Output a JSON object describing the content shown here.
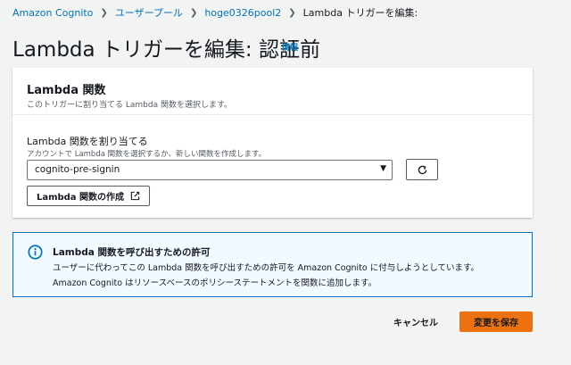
{
  "breadcrumb": {
    "items": [
      "Amazon Cognito",
      "ユーザープール",
      "hoge0326pool2"
    ],
    "current": "Lambda トリガーを編集:"
  },
  "header": {
    "title": "Lambda トリガーを編集: 認証前",
    "info_link": "情報"
  },
  "panel": {
    "title": "Lambda 関数",
    "description": "このトリガーに割り当てる Lambda 関数を選択します。",
    "field_label": "Lambda 関数を割り当てる",
    "field_description": "アカウントで Lambda 関数を選択するか、新しい関数を作成します。",
    "selected_function": "cognito-pre-signin",
    "create_button": "Lambda 関数の作成"
  },
  "alert": {
    "title": "Lambda 関数を呼び出すための許可",
    "line1": "ユーザーに代わってこの Lambda 関数を呼び出すための許可を Amazon Cognito に付与しようとしています。",
    "line2": "Amazon Cognito はリソースベースのポリシーステートメントを関数に追加します。"
  },
  "footer": {
    "cancel_label": "キャンセル",
    "save_label": "変更を保存"
  },
  "colors": {
    "link": "#0073bb",
    "primary_button": "#ec7211",
    "alert_border": "#0073bb",
    "alert_background": "#f1faff"
  },
  "icons": {
    "breadcrumb_separator": "chevron-right-icon",
    "select_arrow": "caret-down-icon",
    "refresh": "refresh-icon",
    "external_link": "external-link-icon",
    "alert_info": "info-icon"
  }
}
